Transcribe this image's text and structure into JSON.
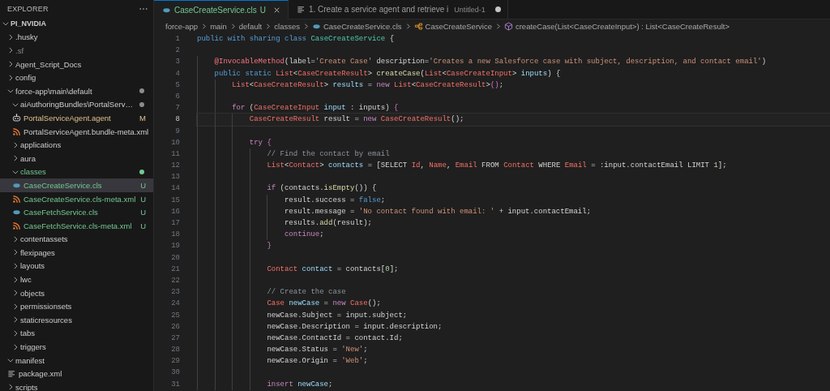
{
  "explorer": {
    "title": "EXPLORER",
    "tree": {
      "label": "PI_NVIDIA",
      "kind": "root",
      "expanded": true,
      "selected": false,
      "modified": false,
      "untracked": false,
      "ignored": false,
      "children": [
        {
          "label": ".husky",
          "kind": "folder",
          "expanded": false,
          "selected": false,
          "modified": false,
          "untracked": false,
          "ignored": false
        },
        {
          "label": ".sf",
          "kind": "folder",
          "expanded": false,
          "selected": false,
          "modified": false,
          "untracked": false,
          "ignored": true
        },
        {
          "label": "Agent_Script_Docs",
          "kind": "folder",
          "expanded": false,
          "selected": false,
          "modified": false,
          "untracked": false,
          "ignored": false
        },
        {
          "label": "config",
          "kind": "folder",
          "expanded": false,
          "selected": false,
          "modified": false,
          "untracked": false,
          "ignored": false
        },
        {
          "label": "force-app\\main\\default",
          "kind": "folder",
          "expanded": true,
          "selected": false,
          "modified": false,
          "untracked": false,
          "ignored": false,
          "dot": {
            "color": "#8c8c8c"
          },
          "children": [
            {
              "label": "aiAuthoringBundles\\PortalServ…",
              "kind": "folder",
              "expanded": true,
              "selected": false,
              "modified": false,
              "untracked": false,
              "ignored": false,
              "dot": {
                "color": "#8c8c8c"
              },
              "children": [
                {
                  "label": "PortalServiceAgent.agent",
                  "kind": "agent",
                  "selected": false,
                  "modified": true,
                  "untracked": false,
                  "ignored": false,
                  "badge": "M"
                },
                {
                  "label": "PortalServiceAgent.bundle-meta.xml",
                  "kind": "xml",
                  "selected": false,
                  "modified": false,
                  "untracked": false,
                  "ignored": false
                }
              ]
            },
            {
              "label": "applications",
              "kind": "folder",
              "expanded": false,
              "selected": false,
              "modified": false,
              "untracked": false,
              "ignored": false
            },
            {
              "label": "aura",
              "kind": "folder",
              "expanded": false,
              "selected": false,
              "modified": false,
              "untracked": false,
              "ignored": false
            },
            {
              "label": "classes",
              "kind": "folder",
              "expanded": true,
              "selected": false,
              "modified": false,
              "untracked": true,
              "ignored": false,
              "dot": {
                "color": "#73c991"
              },
              "children": [
                {
                  "label": "CaseCreateService.cls",
                  "kind": "apex",
                  "selected": true,
                  "modified": false,
                  "untracked": true,
                  "ignored": false,
                  "badge": "U"
                },
                {
                  "label": "CaseCreateService.cls-meta.xml",
                  "kind": "xml",
                  "selected": false,
                  "modified": false,
                  "untracked": true,
                  "ignored": false,
                  "badge": "U"
                },
                {
                  "label": "CaseFetchService.cls",
                  "kind": "apex",
                  "selected": false,
                  "modified": false,
                  "untracked": true,
                  "ignored": false,
                  "badge": "U"
                },
                {
                  "label": "CaseFetchService.cls-meta.xml",
                  "kind": "xml",
                  "selected": false,
                  "modified": false,
                  "untracked": true,
                  "ignored": false,
                  "badge": "U"
                }
              ]
            },
            {
              "label": "contentassets",
              "kind": "folder",
              "expanded": false,
              "selected": false,
              "modified": false,
              "untracked": false,
              "ignored": false
            },
            {
              "label": "flexipages",
              "kind": "folder",
              "expanded": false,
              "selected": false,
              "modified": false,
              "untracked": false,
              "ignored": false
            },
            {
              "label": "layouts",
              "kind": "folder",
              "expanded": false,
              "selected": false,
              "modified": false,
              "untracked": false,
              "ignored": false
            },
            {
              "label": "lwc",
              "kind": "folder",
              "expanded": false,
              "selected": false,
              "modified": false,
              "untracked": false,
              "ignored": false
            },
            {
              "label": "objects",
              "kind": "folder",
              "expanded": false,
              "selected": false,
              "modified": false,
              "untracked": false,
              "ignored": false
            },
            {
              "label": "permissionsets",
              "kind": "folder",
              "expanded": false,
              "selected": false,
              "modified": false,
              "untracked": false,
              "ignored": false
            },
            {
              "label": "staticresources",
              "kind": "folder",
              "expanded": false,
              "selected": false,
              "modified": false,
              "untracked": false,
              "ignored": false
            },
            {
              "label": "tabs",
              "kind": "folder",
              "expanded": false,
              "selected": false,
              "modified": false,
              "untracked": false,
              "ignored": false
            },
            {
              "label": "triggers",
              "kind": "folder",
              "expanded": false,
              "selected": false,
              "modified": false,
              "untracked": false,
              "ignored": false
            }
          ]
        },
        {
          "label": "manifest",
          "kind": "folder",
          "expanded": true,
          "selected": false,
          "modified": false,
          "untracked": false,
          "ignored": false,
          "children": [
            {
              "label": "package.xml",
              "kind": "text",
              "selected": false,
              "modified": false,
              "untracked": false,
              "ignored": false
            }
          ]
        },
        {
          "label": "scripts",
          "kind": "folder",
          "expanded": false,
          "selected": false,
          "modified": false,
          "untracked": false,
          "ignored": false
        }
      ]
    }
  },
  "tabs": [
    {
      "label": "CaseCreateService.cls",
      "kind": "apex",
      "selected": true,
      "untracked": true,
      "badge": "U",
      "closable": true,
      "dirty": false
    },
    {
      "label": "1. Create a service agent and retrieve i",
      "kind": "text",
      "selected": false,
      "untracked": false,
      "description": "Untitled-1",
      "closable": false,
      "dirty": true
    }
  ],
  "breadcrumb": [
    {
      "label": "force-app",
      "kind": "folder"
    },
    {
      "label": "main",
      "kind": "folder"
    },
    {
      "label": "default",
      "kind": "folder"
    },
    {
      "label": "classes",
      "kind": "folder"
    },
    {
      "label": "CaseCreateService.cls",
      "kind": "apex"
    },
    {
      "label": "CaseCreateService",
      "kind": "class"
    },
    {
      "label": "createCase(List<CaseCreateInput>) : List<CaseCreateResult>",
      "kind": "method"
    }
  ],
  "code": [
    {
      "number": "1",
      "current": false,
      "tokens": [
        {
          "text": "public with sharing class ",
          "kind": "kw"
        },
        {
          "text": "CaseCreateService",
          "kind": "cls"
        },
        {
          "text": " {",
          "kind": "txt"
        }
      ]
    },
    {
      "number": "2",
      "current": false
    },
    {
      "number": "3",
      "current": false,
      "tokens": [
        {
          "text": "    @InvocableMethod",
          "kind": "ann"
        },
        {
          "text": "(label=",
          "kind": "txt"
        },
        {
          "text": "'Create Case'",
          "kind": "str"
        },
        {
          "text": " description=",
          "kind": "txt"
        },
        {
          "text": "'Creates a new Salesforce case with subject, description, and contact email'",
          "kind": "str"
        },
        {
          "text": ")",
          "kind": "txt"
        }
      ]
    },
    {
      "number": "4",
      "current": false,
      "tokens": [
        {
          "text": "    public static ",
          "kind": "kw"
        },
        {
          "text": "List",
          "kind": "type"
        },
        {
          "text": "<",
          "kind": "txt"
        },
        {
          "text": "CaseCreateResult",
          "kind": "type"
        },
        {
          "text": "> ",
          "kind": "txt"
        },
        {
          "text": "createCase",
          "kind": "fn"
        },
        {
          "text": "(",
          "kind": "txt"
        },
        {
          "text": "List",
          "kind": "type"
        },
        {
          "text": "<",
          "kind": "txt"
        },
        {
          "text": "CaseCreateInput",
          "kind": "type"
        },
        {
          "text": "> ",
          "kind": "txt"
        },
        {
          "text": "inputs",
          "kind": "var"
        },
        {
          "text": ") {",
          "kind": "txt"
        }
      ]
    },
    {
      "number": "5",
      "current": false,
      "tokens": [
        {
          "text": "        List",
          "kind": "type"
        },
        {
          "text": "<",
          "kind": "txt"
        },
        {
          "text": "CaseCreateResult",
          "kind": "type"
        },
        {
          "text": "> ",
          "kind": "txt"
        },
        {
          "text": "results",
          "kind": "var"
        },
        {
          "text": " = ",
          "kind": "txt"
        },
        {
          "text": "new ",
          "kind": "ctl"
        },
        {
          "text": "List",
          "kind": "type"
        },
        {
          "text": "<",
          "kind": "txt"
        },
        {
          "text": "CaseCreateResult",
          "kind": "type"
        },
        {
          "text": ">",
          "kind": "txt"
        },
        {
          "text": "()",
          "kind": "brk"
        },
        {
          "text": ";",
          "kind": "txt"
        }
      ]
    },
    {
      "number": "6",
      "current": false
    },
    {
      "number": "7",
      "current": false,
      "tokens": [
        {
          "text": "        for",
          "kind": "ctl"
        },
        {
          "text": " (",
          "kind": "txt"
        },
        {
          "text": "CaseCreateInput",
          "kind": "type"
        },
        {
          "text": " input",
          "kind": "var"
        },
        {
          "text": " : inputs) ",
          "kind": "txt"
        },
        {
          "text": "{",
          "kind": "brk"
        }
      ]
    },
    {
      "number": "8",
      "current": true,
      "tokens": [
        {
          "text": "            CaseCreateResult",
          "kind": "type"
        },
        {
          "text": " result = ",
          "kind": "txt"
        },
        {
          "text": "new ",
          "kind": "ctl"
        },
        {
          "text": "CaseCreateResult",
          "kind": "type"
        },
        {
          "text": "();",
          "kind": "txt"
        }
      ]
    },
    {
      "number": "9",
      "current": false
    },
    {
      "number": "10",
      "current": false,
      "tokens": [
        {
          "text": "            try",
          "kind": "ctl"
        },
        {
          "text": " {",
          "kind": "brk"
        }
      ]
    },
    {
      "number": "11",
      "current": false,
      "tokens": [
        {
          "text": "                // Find the contact by email",
          "kind": "cmt"
        }
      ]
    },
    {
      "number": "12",
      "current": false,
      "tokens": [
        {
          "text": "                List",
          "kind": "type"
        },
        {
          "text": "<",
          "kind": "txt"
        },
        {
          "text": "Contact",
          "kind": "type"
        },
        {
          "text": "> ",
          "kind": "txt"
        },
        {
          "text": "contacts",
          "kind": "var"
        },
        {
          "text": " = [SELECT ",
          "kind": "txt"
        },
        {
          "text": "Id",
          "kind": "type"
        },
        {
          "text": ", ",
          "kind": "txt"
        },
        {
          "text": "Name",
          "kind": "type"
        },
        {
          "text": ", ",
          "kind": "txt"
        },
        {
          "text": "Email",
          "kind": "type"
        },
        {
          "text": " FROM ",
          "kind": "txt"
        },
        {
          "text": "Contact",
          "kind": "type"
        },
        {
          "text": " WHERE ",
          "kind": "txt"
        },
        {
          "text": "Email",
          "kind": "type"
        },
        {
          "text": " = :input.contactEmail LIMIT ",
          "kind": "txt"
        },
        {
          "text": "1",
          "kind": "num"
        },
        {
          "text": "];",
          "kind": "txt"
        }
      ]
    },
    {
      "number": "13",
      "current": false
    },
    {
      "number": "14",
      "current": false,
      "tokens": [
        {
          "text": "                if",
          "kind": "ctl"
        },
        {
          "text": " (contacts.",
          "kind": "txt"
        },
        {
          "text": "isEmpty",
          "kind": "fn"
        },
        {
          "text": "()) {",
          "kind": "txt"
        }
      ]
    },
    {
      "number": "15",
      "current": false,
      "tokens": [
        {
          "text": "                    result.success = ",
          "kind": "txt"
        },
        {
          "text": "false",
          "kind": "kw"
        },
        {
          "text": ";",
          "kind": "txt"
        }
      ]
    },
    {
      "number": "16",
      "current": false,
      "tokens": [
        {
          "text": "                    result.message = ",
          "kind": "txt"
        },
        {
          "text": "'No contact found with email: '",
          "kind": "str"
        },
        {
          "text": " + input.contactEmail;",
          "kind": "txt"
        }
      ]
    },
    {
      "number": "17",
      "current": false,
      "tokens": [
        {
          "text": "                    results.",
          "kind": "txt"
        },
        {
          "text": "add",
          "kind": "fn"
        },
        {
          "text": "(result);",
          "kind": "txt"
        }
      ]
    },
    {
      "number": "18",
      "current": false,
      "tokens": [
        {
          "text": "                    continue",
          "kind": "ctl"
        },
        {
          "text": ";",
          "kind": "txt"
        }
      ]
    },
    {
      "number": "19",
      "current": false,
      "tokens": [
        {
          "text": "                }",
          "kind": "ctl"
        }
      ]
    },
    {
      "number": "20",
      "current": false
    },
    {
      "number": "21",
      "current": false,
      "tokens": [
        {
          "text": "                Contact",
          "kind": "type"
        },
        {
          "text": " contact",
          "kind": "var"
        },
        {
          "text": " = contacts[",
          "kind": "txt"
        },
        {
          "text": "0",
          "kind": "num"
        },
        {
          "text": "];",
          "kind": "txt"
        }
      ]
    },
    {
      "number": "22",
      "current": false
    },
    {
      "number": "23",
      "current": false,
      "tokens": [
        {
          "text": "                // Create the case",
          "kind": "cmt"
        }
      ]
    },
    {
      "number": "24",
      "current": false,
      "tokens": [
        {
          "text": "                Case",
          "kind": "type"
        },
        {
          "text": " newCase",
          "kind": "var"
        },
        {
          "text": " = ",
          "kind": "txt"
        },
        {
          "text": "new ",
          "kind": "ctl"
        },
        {
          "text": "Case",
          "kind": "type"
        },
        {
          "text": "();",
          "kind": "txt"
        }
      ]
    },
    {
      "number": "25",
      "current": false,
      "tokens": [
        {
          "text": "                newCase.Subject = input.subject;",
          "kind": "txt"
        }
      ]
    },
    {
      "number": "26",
      "current": false,
      "tokens": [
        {
          "text": "                newCase.Description = input.description;",
          "kind": "txt"
        }
      ]
    },
    {
      "number": "27",
      "current": false,
      "tokens": [
        {
          "text": "                newCase.ContactId = contact.Id;",
          "kind": "txt"
        }
      ]
    },
    {
      "number": "28",
      "current": false,
      "tokens": [
        {
          "text": "                newCase.Status = ",
          "kind": "txt"
        },
        {
          "text": "'New'",
          "kind": "str"
        },
        {
          "text": ";",
          "kind": "txt"
        }
      ]
    },
    {
      "number": "29",
      "current": false,
      "tokens": [
        {
          "text": "                newCase.Origin = ",
          "kind": "txt"
        },
        {
          "text": "'Web'",
          "kind": "str"
        },
        {
          "text": ";",
          "kind": "txt"
        }
      ]
    },
    {
      "number": "30",
      "current": false
    },
    {
      "number": "31",
      "current": false,
      "tokens": [
        {
          "text": "                insert ",
          "kind": "ctl"
        },
        {
          "text": "newCase",
          "kind": "var"
        },
        {
          "text": ";",
          "kind": "txt"
        }
      ]
    }
  ]
}
